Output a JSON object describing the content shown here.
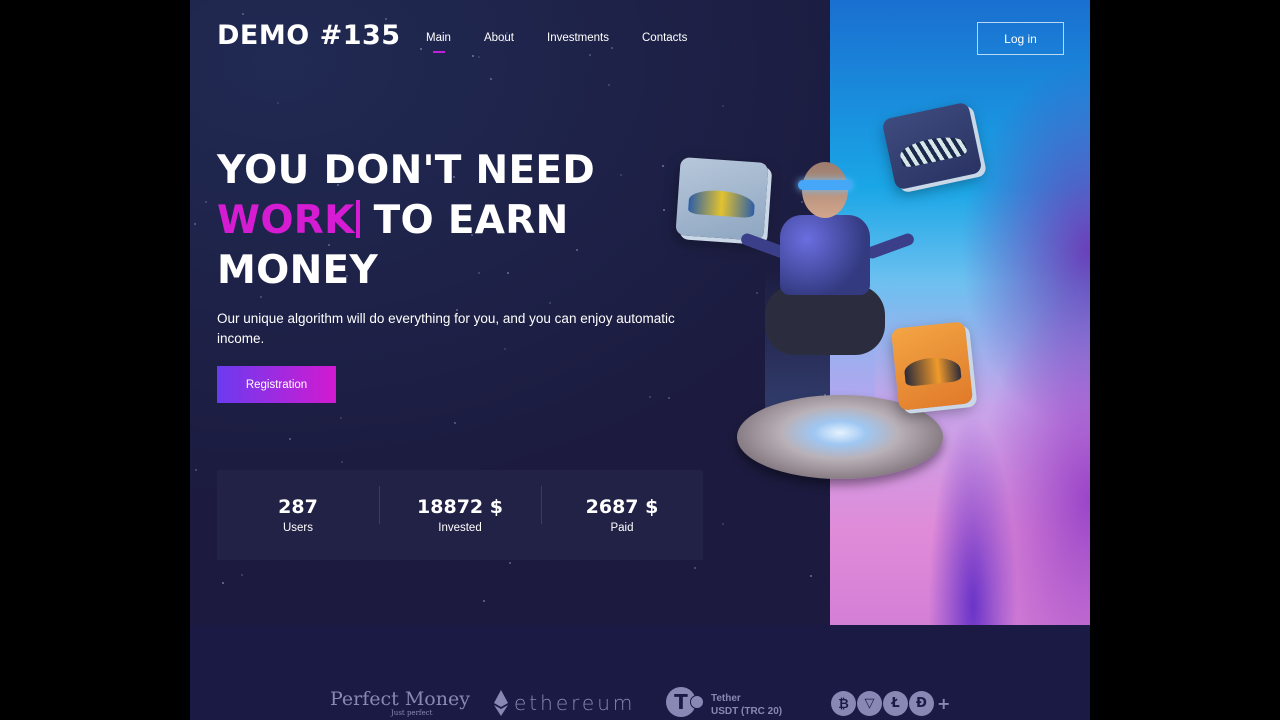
{
  "header": {
    "logo": "DEMO #135",
    "nav": [
      {
        "label": "Main",
        "active": true
      },
      {
        "label": "About",
        "active": false
      },
      {
        "label": "Investments",
        "active": false
      },
      {
        "label": "Contacts",
        "active": false
      }
    ],
    "login_label": "Log in"
  },
  "hero": {
    "headline_line1": "YOU DON'T NEED",
    "headline_accent": "WORK",
    "headline_line2_rest": "TO EARN",
    "headline_line3": "MONEY",
    "subtext": "Our unique algorithm will do everything for you, and you can enjoy automatic income.",
    "cta_label": "Registration"
  },
  "stats": [
    {
      "value": "287",
      "label": "Users"
    },
    {
      "value": "18872 $",
      "label": "Invested"
    },
    {
      "value": "2687 $",
      "label": "Paid"
    }
  ],
  "payments": {
    "perfect_money": "Perfect Money",
    "perfect_money_tagline": "Just perfect",
    "ethereum": "ethereum",
    "tether_name": "Tether",
    "tether_sub": "USDT (TRC 20)",
    "coins": [
      {
        "icon": "bitcoin-icon",
        "glyph": "₿"
      },
      {
        "icon": "tron-icon",
        "glyph": "▽"
      },
      {
        "icon": "litecoin-icon",
        "glyph": "Ł"
      },
      {
        "icon": "dogecoin-icon",
        "glyph": "Ð"
      }
    ],
    "more": "+"
  },
  "colors": {
    "accent": "#d51cd2",
    "cta_start": "#6b3bf0",
    "cta_end": "#d21ad0",
    "background": "#1c1b3f"
  }
}
